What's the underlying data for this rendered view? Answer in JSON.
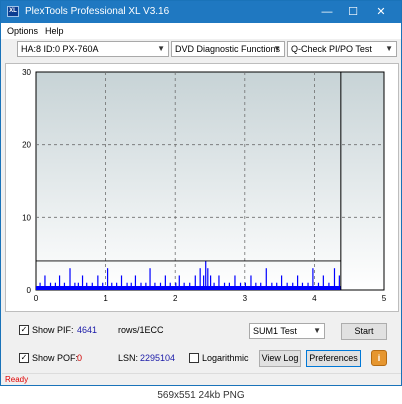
{
  "window": {
    "title": "PlexTools Professional XL V3.16",
    "icon_label": "XL",
    "controls": {
      "minimize": "—",
      "maximize": "☐",
      "close": "✕"
    }
  },
  "menu": {
    "items": [
      "Options",
      "Help"
    ]
  },
  "toolbar": {
    "drive": "HA:8 ID:0  PX-760A",
    "function": "DVD Diagnostic Functions",
    "test": "Q-Check PI/PO Test"
  },
  "chart_data": {
    "type": "bar",
    "xlim": [
      0,
      5
    ],
    "ylim": [
      0,
      30
    ],
    "x_ticks": [
      "0",
      "1",
      "2",
      "3",
      "4",
      "5"
    ],
    "y_ticks": [
      "0",
      "10",
      "20",
      "30"
    ],
    "grid": true,
    "marker_x": 4.38,
    "threshold_y": 4,
    "colors": {
      "bars": "#0000ff",
      "plot_top": "#c7d3d6",
      "plot_bottom": "#ffffff"
    },
    "series": [
      {
        "x": [
          0.05,
          0.12,
          0.2,
          0.27,
          0.33,
          0.4,
          0.48,
          0.55,
          0.6,
          0.66,
          0.72,
          0.8,
          0.88,
          0.95,
          1.02,
          1.08,
          1.15,
          1.22,
          1.3,
          1.36,
          1.42,
          1.5,
          1.57,
          1.63,
          1.7,
          1.78,
          1.85,
          1.92,
          2.0,
          2.05,
          2.12,
          2.2,
          2.28,
          2.35,
          2.4,
          2.43,
          2.46,
          2.5,
          2.55,
          2.62,
          2.7,
          2.77,
          2.85,
          2.93,
          3.0,
          3.08,
          3.15,
          3.22,
          3.3,
          3.38,
          3.45,
          3.52,
          3.6,
          3.68,
          3.75,
          3.82,
          3.9,
          3.97,
          4.05,
          4.12,
          4.2,
          4.28,
          4.35
        ],
        "values": [
          1,
          2,
          1,
          1,
          2,
          1,
          3,
          1,
          1,
          2,
          1,
          1,
          2,
          1,
          3,
          1,
          1,
          2,
          1,
          1,
          2,
          1,
          1,
          3,
          1,
          1,
          2,
          1,
          1,
          2,
          1,
          1,
          2,
          3,
          2,
          4,
          3,
          2,
          1,
          2,
          1,
          1,
          2,
          1,
          1,
          2,
          1,
          1,
          3,
          1,
          1,
          2,
          1,
          1,
          2,
          1,
          1,
          3,
          1,
          2,
          1,
          3,
          2
        ]
      }
    ]
  },
  "controls": {
    "show_pif_label": "Show PIF:",
    "pif_value": "4641",
    "rows_label": "rows/1ECC",
    "show_pof_label": "Show POF:",
    "pof_value": "0",
    "lsn_label": "LSN:",
    "lsn_value": "2295104",
    "logarithmic_label": "Logarithmic",
    "check_mark": "✓",
    "sum_select": "SUM1 Test",
    "start_button": "Start",
    "view_log_button": "View Log",
    "preferences_button": "Preferences",
    "info_icon_glyph": "i"
  },
  "status": {
    "text": "Ready"
  },
  "caption": "569x551 24kb PNG"
}
